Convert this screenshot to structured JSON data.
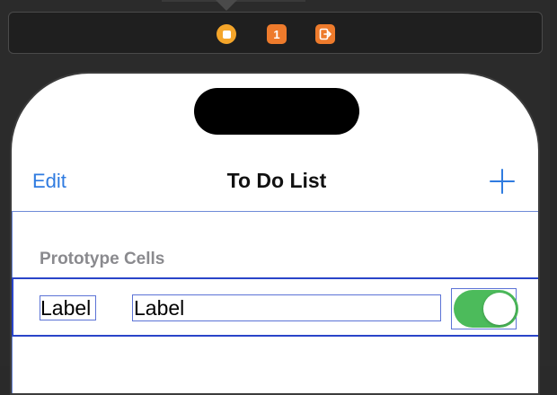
{
  "dock": {
    "icons": [
      "view-controller-icon",
      "first-responder-icon",
      "exit-icon"
    ],
    "first_responder_glyph": "1",
    "exit_glyph": "↦"
  },
  "nav": {
    "edit_label": "Edit",
    "title": "To Do List"
  },
  "table": {
    "section_header": "Prototype Cells",
    "cell": {
      "label1": "Label",
      "label2": "Label",
      "switch_on": true
    }
  },
  "colors": {
    "accent": "#2f7be0",
    "switch_on": "#4cbb5b",
    "selection_outline": "#2a45c9",
    "dock_icon_orange": "#ee7b2c",
    "dock_icon_yellow": "#f4a52a"
  }
}
